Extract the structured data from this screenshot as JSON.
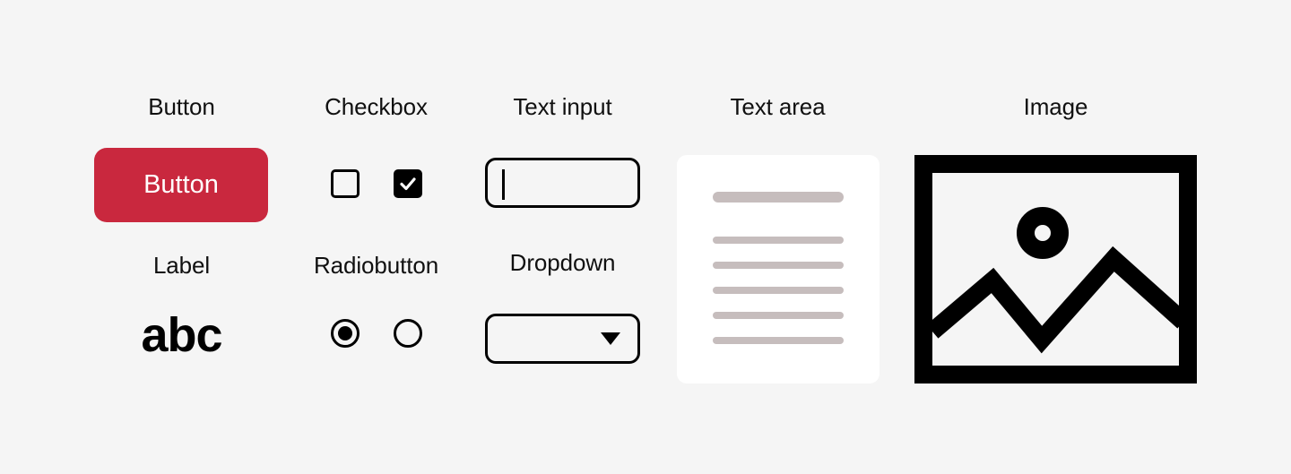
{
  "page": {
    "background_color": "#f5f5f5",
    "title_text_color": "#101010"
  },
  "columns": [
    {
      "id": "button-column",
      "title": "Button",
      "second_title": "Label"
    },
    {
      "id": "checkbox-column",
      "title": "Checkbox",
      "second_title": "Radiobutton"
    },
    {
      "id": "textinput-column",
      "title": "Text input",
      "second_title": "Dropdown"
    },
    {
      "id": "textarea-column",
      "title": "Text area"
    },
    {
      "id": "image-column",
      "title": "Image"
    }
  ],
  "button": {
    "label": "Button",
    "background_color": "#c9283e",
    "text_color": "#ffffff"
  },
  "label": {
    "sample_text": "abc",
    "text_color": "#000000"
  },
  "checkbox": {
    "items": [
      {
        "name": "unchecked",
        "checked": false
      },
      {
        "name": "checked",
        "checked": true,
        "glyph": "checkmark-icon"
      }
    ],
    "stroke_color": "#000000",
    "fill_color": "#000000"
  },
  "radiobutton": {
    "items": [
      {
        "name": "selected",
        "selected": true
      },
      {
        "name": "unselected",
        "selected": false
      }
    ],
    "stroke_color": "#000000"
  },
  "text_input": {
    "value": "",
    "placeholder": "",
    "caret_visible": true,
    "border_color": "#000000"
  },
  "dropdown": {
    "selected_value": "",
    "caret_icon": "chevron-down-icon",
    "border_color": "#000000"
  },
  "text_area": {
    "card_color": "#ffffff",
    "line_color": "#c6bdbd",
    "lines": [
      {
        "type": "title",
        "width_pct": 100
      },
      {
        "type": "body",
        "width_pct": 100
      },
      {
        "type": "body",
        "width_pct": 100
      },
      {
        "type": "body",
        "width_pct": 100
      },
      {
        "type": "body",
        "width_pct": 100
      },
      {
        "type": "body",
        "width_pct": 100
      }
    ]
  },
  "image": {
    "icon": "image-placeholder-icon",
    "stroke_color": "#000000",
    "fill_color": "#f5f5f5"
  }
}
